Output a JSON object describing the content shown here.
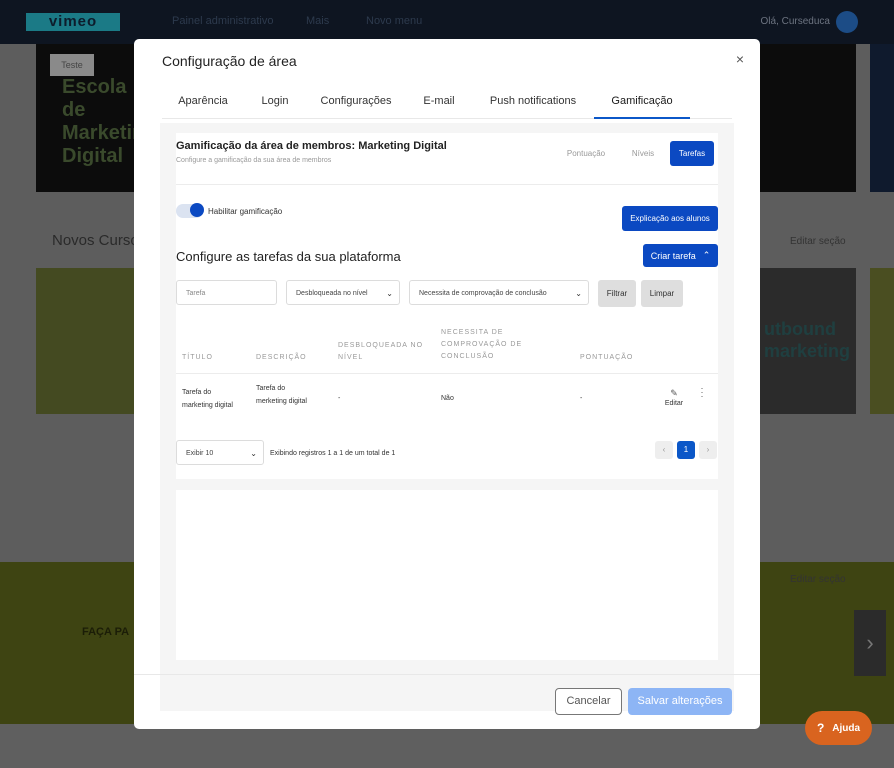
{
  "background": {
    "logo": "vimeo",
    "nav_items": [
      "Painel administrativo",
      "Mais",
      "Novo menu"
    ],
    "user_greeting": "Olá, Curseduca",
    "hero_tag": "Teste",
    "hero_text": "Escola de Marketing Digital",
    "section1_title": "Novos Cursos",
    "edit_section_label": "Editar seção",
    "card_text": "utbound marketing",
    "banner_text": "FAÇA PA",
    "arrow": "›"
  },
  "help_button": {
    "icon": "?",
    "label": "Ajuda"
  },
  "modal": {
    "title": "Configuração de área",
    "close_icon": "×",
    "tabs": [
      {
        "label": "Aparência"
      },
      {
        "label": "Login"
      },
      {
        "label": "Configurações"
      },
      {
        "label": "E-mail"
      },
      {
        "label": "Push notifications"
      },
      {
        "label": "Gamificação",
        "active": true
      }
    ],
    "gamification": {
      "title": "Gamificação da área de membros: Marketing Digital",
      "subtitle": "Configure a gamificação da sua área de membros",
      "segments": [
        {
          "label": "Pontuação"
        },
        {
          "label": "Níveis"
        },
        {
          "label": "Tarefas",
          "active": true
        }
      ],
      "toggle_label": "Habilitar gamificação",
      "toggle_on": true,
      "explain_button": "Explicação aos alunos",
      "tasks_title": "Configure as tarefas da sua plataforma",
      "create_button": "Criar tarefa",
      "create_icon": "⌃",
      "filters": {
        "task_placeholder": "Tarefa",
        "level_select": "Desbloqueada no nível",
        "proof_select": "Necessita de comprovação de conclusão",
        "filter_button": "Filtrar",
        "clear_button": "Limpar"
      },
      "table": {
        "headers": {
          "title": "TÍTULO",
          "description": "DESCRIÇÃO",
          "unlocked_1": "DESBLOQUEADA NO",
          "unlocked_2": "NÍVEL",
          "proof_1": "NECESSITA DE",
          "proof_2": "COMPROVAÇÃO DE",
          "proof_3": "CONCLUSÃO",
          "points": "PONTUAÇÃO"
        },
        "rows": [
          {
            "title_1": "Tarefa do",
            "title_2": "marketing digital",
            "desc_1": "Tarefa do",
            "desc_2": "merketing digital",
            "level": "-",
            "proof": "Não",
            "points": "-",
            "edit_label": "Editar"
          }
        ]
      },
      "pagination": {
        "page_size_select": "Exibir 10",
        "records_text": "Exibindo registros 1 a 1 de um total de 1",
        "prev": "‹",
        "current_page": "1",
        "next": "›"
      }
    },
    "cancel_button": "Cancelar",
    "save_button": "Salvar alterações"
  },
  "colors": {
    "accent": "#0b49c2",
    "help": "#d9641f",
    "save_disabled": "#8db5f5"
  }
}
